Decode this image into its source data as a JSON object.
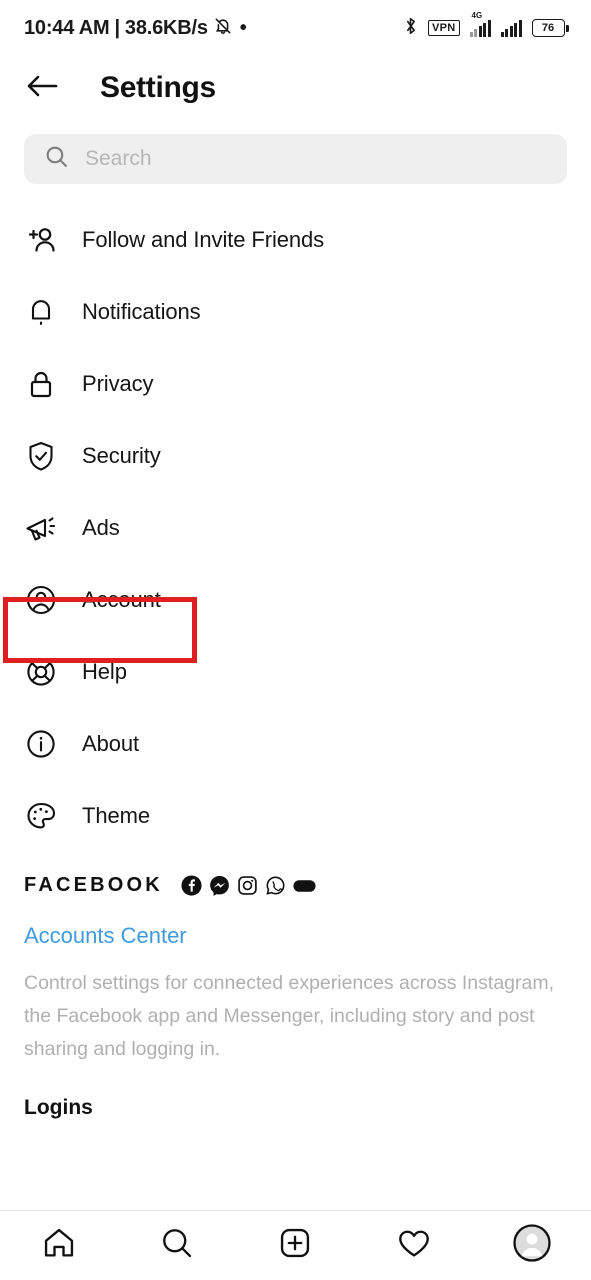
{
  "status_bar": {
    "time": "10:44 AM",
    "separator": "|",
    "network_speed": "38.6KB/s",
    "notifications_muted_icon": "bell-muted-icon",
    "dot": "•",
    "bluetooth_icon": "bluetooth-icon",
    "vpn_label": "VPN",
    "network_type": "4G",
    "battery_level": "76"
  },
  "header": {
    "back_icon": "back-arrow-icon",
    "title": "Settings"
  },
  "search": {
    "icon": "search-icon",
    "placeholder": "Search",
    "value": ""
  },
  "menu": {
    "items": [
      {
        "label": "Follow and Invite Friends",
        "icon": "add-person-icon",
        "highlighted": false
      },
      {
        "label": "Notifications",
        "icon": "bell-icon",
        "highlighted": false
      },
      {
        "label": "Privacy",
        "icon": "lock-icon",
        "highlighted": false
      },
      {
        "label": "Security",
        "icon": "shield-check-icon",
        "highlighted": false
      },
      {
        "label": "Ads",
        "icon": "megaphone-icon",
        "highlighted": false
      },
      {
        "label": "Account",
        "icon": "account-circle-icon",
        "highlighted": true
      },
      {
        "label": "Help",
        "icon": "lifebuoy-icon",
        "highlighted": false
      },
      {
        "label": "About",
        "icon": "info-circle-icon",
        "highlighted": false
      },
      {
        "label": "Theme",
        "icon": "palette-icon",
        "highlighted": false
      }
    ]
  },
  "facebook_section": {
    "heading": "FACEBOOK",
    "brand_icons": [
      "facebook-icon",
      "messenger-icon",
      "instagram-icon",
      "whatsapp-icon",
      "meta-oval-icon"
    ],
    "accounts_center_link": "Accounts Center",
    "description": "Control settings for connected experiences across Instagram, the Facebook app and Messenger, including story and post sharing and logging in.",
    "logins_label": "Logins"
  },
  "bottom_nav": {
    "items": [
      {
        "icon": "home-icon",
        "name": "nav-home"
      },
      {
        "icon": "search-icon",
        "name": "nav-search"
      },
      {
        "icon": "add-post-icon",
        "name": "nav-create"
      },
      {
        "icon": "heart-icon",
        "name": "nav-activity"
      },
      {
        "icon": "profile-avatar-icon",
        "name": "nav-profile"
      }
    ]
  },
  "colors": {
    "highlight_box": "#e02020",
    "link": "#3f9ae0",
    "search_background": "#efefef",
    "muted_text": "#b0b0b0",
    "primary_text": "#111111"
  }
}
